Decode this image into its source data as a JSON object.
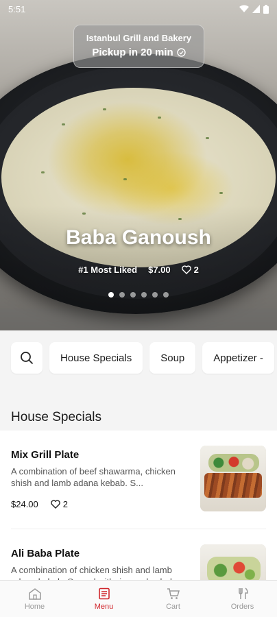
{
  "status_bar": {
    "time": "5:51"
  },
  "header": {
    "restaurant_name": "Istanbul Grill and Bakery",
    "pickup_label": "Pickup in 20 min"
  },
  "featured": {
    "name": "Baba Ganoush",
    "rank": "#1 Most Liked",
    "price": "$7.00",
    "likes": "2",
    "slides": 6,
    "active_slide": 1
  },
  "categories": {
    "items": [
      "House Specials",
      "Soup",
      "Appetizer -"
    ]
  },
  "section": {
    "title": "House Specials"
  },
  "menu_items": [
    {
      "name": "Mix Grill Plate",
      "description": "A combination of beef shawarma, chicken shish and lamb adana kebab. S...",
      "price": "$24.00",
      "likes": "2"
    },
    {
      "name": "Ali Baba Plate",
      "description": "A combination of chicken shish and lamb adana kebab. Served with rice and salad"
    }
  ],
  "bottom_nav": {
    "home": "Home",
    "menu": "Menu",
    "cart": "Cart",
    "orders": "Orders",
    "active": "Menu"
  },
  "colors": {
    "accent": "#d0252b",
    "nav_inactive": "#9a9a9a",
    "page_bg": "#f4f4f4"
  },
  "icons": {
    "wifi": "wifi-icon",
    "battery": "battery-icon",
    "check_circle": "check-circle-icon",
    "heart": "heart-icon",
    "search": "search-icon",
    "home": "home-icon",
    "menu": "menu-doc-icon",
    "cart": "cart-icon",
    "orders": "utensils-icon"
  }
}
